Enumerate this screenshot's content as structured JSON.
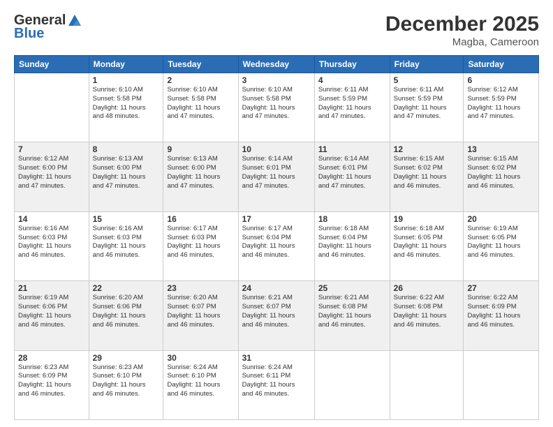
{
  "header": {
    "logo_general": "General",
    "logo_blue": "Blue",
    "month_title": "December 2025",
    "location": "Magba, Cameroon"
  },
  "days_of_week": [
    "Sunday",
    "Monday",
    "Tuesday",
    "Wednesday",
    "Thursday",
    "Friday",
    "Saturday"
  ],
  "weeks": [
    [
      {
        "day": "",
        "sunrise": "",
        "sunset": "",
        "daylight": ""
      },
      {
        "day": "1",
        "sunrise": "Sunrise: 6:10 AM",
        "sunset": "Sunset: 5:58 PM",
        "daylight": "Daylight: 11 hours and 48 minutes."
      },
      {
        "day": "2",
        "sunrise": "Sunrise: 6:10 AM",
        "sunset": "Sunset: 5:58 PM",
        "daylight": "Daylight: 11 hours and 47 minutes."
      },
      {
        "day": "3",
        "sunrise": "Sunrise: 6:10 AM",
        "sunset": "Sunset: 5:58 PM",
        "daylight": "Daylight: 11 hours and 47 minutes."
      },
      {
        "day": "4",
        "sunrise": "Sunrise: 6:11 AM",
        "sunset": "Sunset: 5:59 PM",
        "daylight": "Daylight: 11 hours and 47 minutes."
      },
      {
        "day": "5",
        "sunrise": "Sunrise: 6:11 AM",
        "sunset": "Sunset: 5:59 PM",
        "daylight": "Daylight: 11 hours and 47 minutes."
      },
      {
        "day": "6",
        "sunrise": "Sunrise: 6:12 AM",
        "sunset": "Sunset: 5:59 PM",
        "daylight": "Daylight: 11 hours and 47 minutes."
      }
    ],
    [
      {
        "day": "7",
        "sunrise": "Sunrise: 6:12 AM",
        "sunset": "Sunset: 6:00 PM",
        "daylight": "Daylight: 11 hours and 47 minutes."
      },
      {
        "day": "8",
        "sunrise": "Sunrise: 6:13 AM",
        "sunset": "Sunset: 6:00 PM",
        "daylight": "Daylight: 11 hours and 47 minutes."
      },
      {
        "day": "9",
        "sunrise": "Sunrise: 6:13 AM",
        "sunset": "Sunset: 6:00 PM",
        "daylight": "Daylight: 11 hours and 47 minutes."
      },
      {
        "day": "10",
        "sunrise": "Sunrise: 6:14 AM",
        "sunset": "Sunset: 6:01 PM",
        "daylight": "Daylight: 11 hours and 47 minutes."
      },
      {
        "day": "11",
        "sunrise": "Sunrise: 6:14 AM",
        "sunset": "Sunset: 6:01 PM",
        "daylight": "Daylight: 11 hours and 47 minutes."
      },
      {
        "day": "12",
        "sunrise": "Sunrise: 6:15 AM",
        "sunset": "Sunset: 6:02 PM",
        "daylight": "Daylight: 11 hours and 46 minutes."
      },
      {
        "day": "13",
        "sunrise": "Sunrise: 6:15 AM",
        "sunset": "Sunset: 6:02 PM",
        "daylight": "Daylight: 11 hours and 46 minutes."
      }
    ],
    [
      {
        "day": "14",
        "sunrise": "Sunrise: 6:16 AM",
        "sunset": "Sunset: 6:03 PM",
        "daylight": "Daylight: 11 hours and 46 minutes."
      },
      {
        "day": "15",
        "sunrise": "Sunrise: 6:16 AM",
        "sunset": "Sunset: 6:03 PM",
        "daylight": "Daylight: 11 hours and 46 minutes."
      },
      {
        "day": "16",
        "sunrise": "Sunrise: 6:17 AM",
        "sunset": "Sunset: 6:03 PM",
        "daylight": "Daylight: 11 hours and 46 minutes."
      },
      {
        "day": "17",
        "sunrise": "Sunrise: 6:17 AM",
        "sunset": "Sunset: 6:04 PM",
        "daylight": "Daylight: 11 hours and 46 minutes."
      },
      {
        "day": "18",
        "sunrise": "Sunrise: 6:18 AM",
        "sunset": "Sunset: 6:04 PM",
        "daylight": "Daylight: 11 hours and 46 minutes."
      },
      {
        "day": "19",
        "sunrise": "Sunrise: 6:18 AM",
        "sunset": "Sunset: 6:05 PM",
        "daylight": "Daylight: 11 hours and 46 minutes."
      },
      {
        "day": "20",
        "sunrise": "Sunrise: 6:19 AM",
        "sunset": "Sunset: 6:05 PM",
        "daylight": "Daylight: 11 hours and 46 minutes."
      }
    ],
    [
      {
        "day": "21",
        "sunrise": "Sunrise: 6:19 AM",
        "sunset": "Sunset: 6:06 PM",
        "daylight": "Daylight: 11 hours and 46 minutes."
      },
      {
        "day": "22",
        "sunrise": "Sunrise: 6:20 AM",
        "sunset": "Sunset: 6:06 PM",
        "daylight": "Daylight: 11 hours and 46 minutes."
      },
      {
        "day": "23",
        "sunrise": "Sunrise: 6:20 AM",
        "sunset": "Sunset: 6:07 PM",
        "daylight": "Daylight: 11 hours and 46 minutes."
      },
      {
        "day": "24",
        "sunrise": "Sunrise: 6:21 AM",
        "sunset": "Sunset: 6:07 PM",
        "daylight": "Daylight: 11 hours and 46 minutes."
      },
      {
        "day": "25",
        "sunrise": "Sunrise: 6:21 AM",
        "sunset": "Sunset: 6:08 PM",
        "daylight": "Daylight: 11 hours and 46 minutes."
      },
      {
        "day": "26",
        "sunrise": "Sunrise: 6:22 AM",
        "sunset": "Sunset: 6:08 PM",
        "daylight": "Daylight: 11 hours and 46 minutes."
      },
      {
        "day": "27",
        "sunrise": "Sunrise: 6:22 AM",
        "sunset": "Sunset: 6:09 PM",
        "daylight": "Daylight: 11 hours and 46 minutes."
      }
    ],
    [
      {
        "day": "28",
        "sunrise": "Sunrise: 6:23 AM",
        "sunset": "Sunset: 6:09 PM",
        "daylight": "Daylight: 11 hours and 46 minutes."
      },
      {
        "day": "29",
        "sunrise": "Sunrise: 6:23 AM",
        "sunset": "Sunset: 6:10 PM",
        "daylight": "Daylight: 11 hours and 46 minutes."
      },
      {
        "day": "30",
        "sunrise": "Sunrise: 6:24 AM",
        "sunset": "Sunset: 6:10 PM",
        "daylight": "Daylight: 11 hours and 46 minutes."
      },
      {
        "day": "31",
        "sunrise": "Sunrise: 6:24 AM",
        "sunset": "Sunset: 6:11 PM",
        "daylight": "Daylight: 11 hours and 46 minutes."
      },
      {
        "day": "",
        "sunrise": "",
        "sunset": "",
        "daylight": ""
      },
      {
        "day": "",
        "sunrise": "",
        "sunset": "",
        "daylight": ""
      },
      {
        "day": "",
        "sunrise": "",
        "sunset": "",
        "daylight": ""
      }
    ]
  ]
}
